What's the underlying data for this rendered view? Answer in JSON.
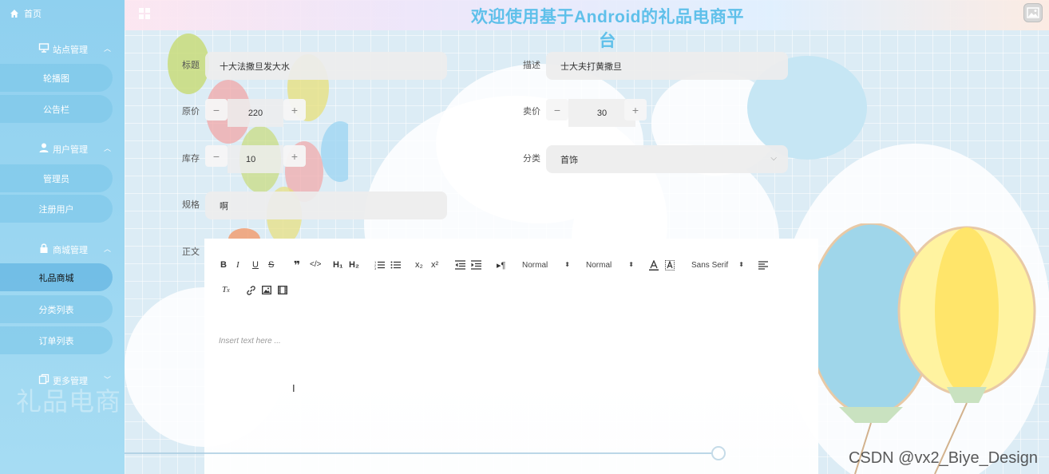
{
  "header": {
    "title": "欢迎使用基于Android的礼品电商平台"
  },
  "sidebar": {
    "home": "首页",
    "groups": [
      {
        "label": "站点管理",
        "items": [
          "轮播图",
          "公告栏"
        ]
      },
      {
        "label": "用户管理",
        "items": [
          "管理员",
          "注册用户"
        ]
      },
      {
        "label": "商城管理",
        "items": [
          "礼品商城",
          "分类列表",
          "订单列表"
        ]
      },
      {
        "label": "更多管理",
        "items": []
      }
    ],
    "watermark": "礼品电商"
  },
  "form": {
    "title_label": "标题",
    "title_value": "十大法撒旦发大水",
    "desc_label": "描述",
    "desc_value": "士大夫打黄撒旦",
    "orig_price_label": "原价",
    "orig_price_value": "220",
    "sell_price_label": "卖价",
    "sell_price_value": "30",
    "stock_label": "库存",
    "stock_value": "10",
    "category_label": "分类",
    "category_value": "首饰",
    "spec_label": "规格",
    "spec_value": "啊",
    "body_label": "正文",
    "minus": "−",
    "plus": "+"
  },
  "editor": {
    "header_select_1": "Normal",
    "header_select_2": "Normal",
    "font_select": "Sans Serif",
    "placeholder": "Insert text here ...",
    "h1": "H₁",
    "h2": "H₂",
    "subscript": "x₂",
    "superscript": "x²"
  },
  "watermark": "CSDN @vx2_Biye_Design",
  "colors": {
    "sidebar": "#8fd0ef",
    "title": "#5fc0ea",
    "field": "#ededed"
  }
}
